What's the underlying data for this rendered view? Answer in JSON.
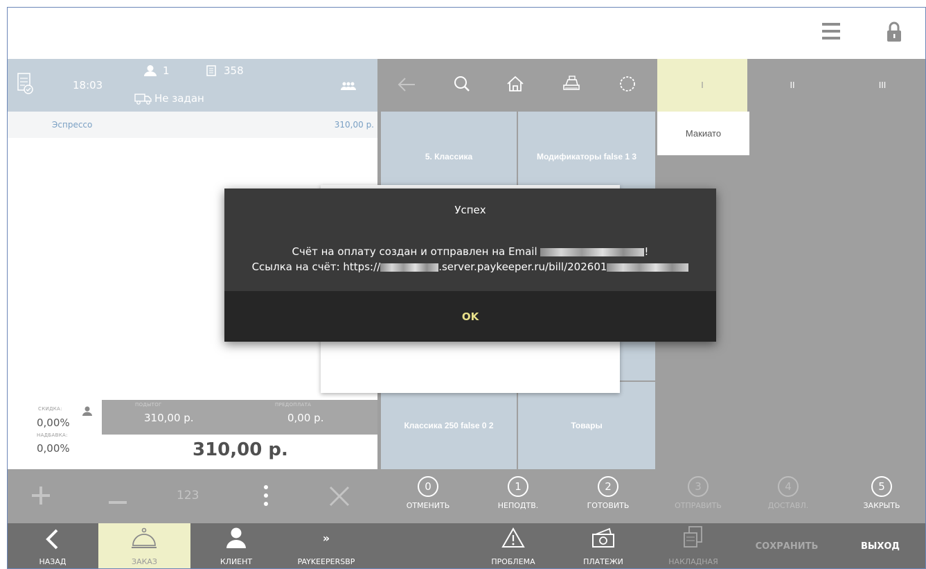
{
  "order": {
    "time": "18:03",
    "guests": "1",
    "check_number": "358",
    "delivery": "Не задан",
    "items": [
      {
        "name": "Эспрессо",
        "price": "310,00 р."
      }
    ]
  },
  "tabs": [
    "I",
    "II",
    "III"
  ],
  "categories": [
    "5. Классика",
    "Модификаторы false 1 3",
    "Классика 250 false 0 2",
    "Товары"
  ],
  "products": [
    "Макиато"
  ],
  "totals": {
    "discount_label": "СКИДКА:",
    "discount_value": "0,00%",
    "surcharge_label": "НАДБАВКА:",
    "surcharge_value": "0,00%",
    "subtotal_label": "ПОДЫТОГ",
    "subtotal_value": "310,00 р.",
    "prepayment_label": "ПРЕДОПЛАТА",
    "prepayment_value": "0,00 р.",
    "total": "310,00 р."
  },
  "actions": {
    "keypad": "123"
  },
  "statuses": [
    {
      "num": "0",
      "label": "ОТМЕНИТЬ"
    },
    {
      "num": "1",
      "label": "НЕПОДТВ."
    },
    {
      "num": "2",
      "label": "ГОТОВИТЬ"
    },
    {
      "num": "3",
      "label": "ОТПРАВИТЬ"
    },
    {
      "num": "4",
      "label": "ДОСТАВЛ."
    },
    {
      "num": "5",
      "label": "ЗАКРЫТЬ"
    }
  ],
  "bottom_nav": {
    "back": "НАЗАД",
    "order": "ЗАКАЗ",
    "client": "КЛИЕНТ",
    "more_glyph": "»",
    "paykeeper": "PAYKEEPERSBP",
    "problem": "ПРОБЛЕМА",
    "payments": "ПЛАТЕЖИ",
    "invoice": "НАКЛАДНАЯ",
    "save": "СОХРАНИТЬ",
    "exit": "ВЫХОД"
  },
  "dialog": {
    "title": "Успех",
    "line1_start": "Счёт на оплату создан и отправлен на Email",
    "line1_end": "!",
    "line2_start": "Ссылка на счёт: https://",
    "line2_mid": ".server.paykeeper.ru/bill/202601",
    "ok": "OK"
  },
  "colors": {
    "active_tab": "#eff0c8",
    "dialog_bg": "#3a3a3a",
    "ok_text": "#e8e08a",
    "header_blue": "#c4d0da"
  }
}
